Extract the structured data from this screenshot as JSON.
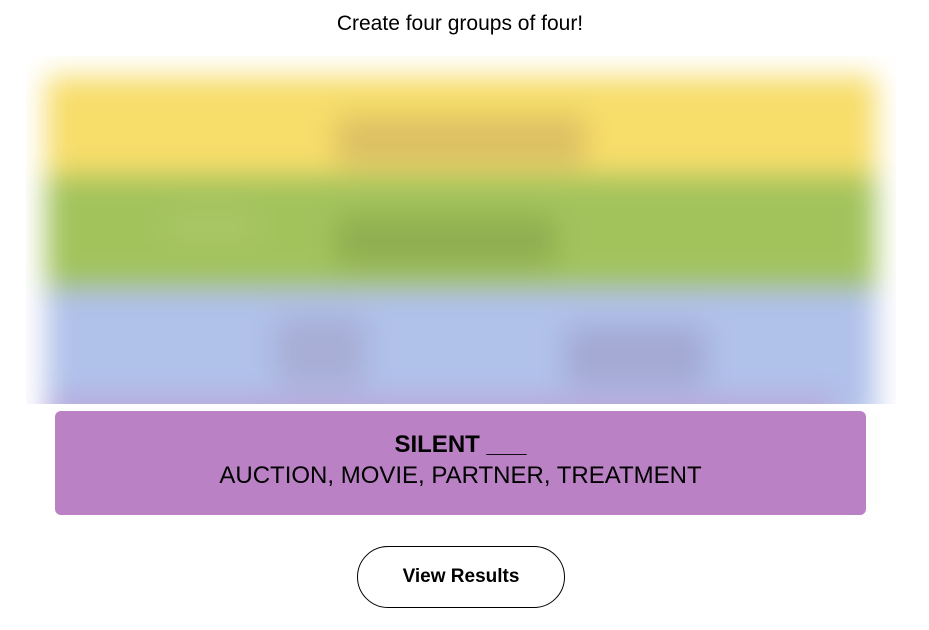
{
  "header": {
    "instructions": "Create four groups of four!"
  },
  "board": {
    "state": "blurred",
    "band_colors": [
      "#f9df6d",
      "#a0c35a",
      "#b0c4ef"
    ]
  },
  "solved_group": {
    "color": "#ba81c5",
    "title": "SILENT ___",
    "members": "AUCTION, MOVIE, PARTNER, TREATMENT"
  },
  "actions": {
    "view_results_label": "View Results"
  }
}
